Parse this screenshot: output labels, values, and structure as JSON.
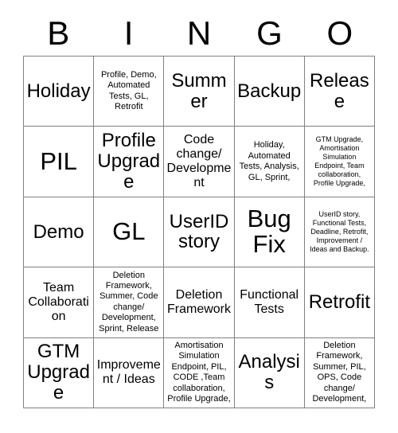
{
  "header": {
    "letters": [
      "B",
      "I",
      "N",
      "G",
      "O"
    ]
  },
  "grid": {
    "columns": 5,
    "rows": 5,
    "border_color": "#808080",
    "background_color": "#ffffff",
    "text_color": "#000000",
    "cells": [
      {
        "text": "Holiday",
        "size": "xl"
      },
      {
        "text": "Profile, Demo, Automated Tests, GL, Retrofit",
        "size": "sm"
      },
      {
        "text": "Summer",
        "size": "xl"
      },
      {
        "text": "Backup",
        "size": "xl"
      },
      {
        "text": "Release",
        "size": "xl"
      },
      {
        "text": "PIL",
        "size": "xxl"
      },
      {
        "text": "Profile Upgrade",
        "size": "xl"
      },
      {
        "text": "Code change/ Development",
        "size": "md"
      },
      {
        "text": "Holiday, Automated Tests, Analysis, GL, Sprint,",
        "size": "sm"
      },
      {
        "text": "GTM Upgrade, Amortisation Simulation Endpoint, Team collaboration, Profile Upgrade,",
        "size": "xs"
      },
      {
        "text": "Demo",
        "size": "xl"
      },
      {
        "text": "GL",
        "size": "xxl"
      },
      {
        "text": "UserID story",
        "size": "xl"
      },
      {
        "text": "Bug Fix",
        "size": "xxl"
      },
      {
        "text": "UserID story, Functional Tests, Deadline, Retrofit, Improvement / Ideas and Backup.",
        "size": "xs"
      },
      {
        "text": "Team Collaboration",
        "size": "md"
      },
      {
        "text": "Deletion Framework, Summer, Code change/ Development, Sprint, Release",
        "size": "sm"
      },
      {
        "text": "Deletion Framework",
        "size": "md"
      },
      {
        "text": "Functional Tests",
        "size": "md"
      },
      {
        "text": "Retrofit",
        "size": "xl"
      },
      {
        "text": "GTM Upgrade",
        "size": "xl"
      },
      {
        "text": "Improvement / Ideas",
        "size": "md"
      },
      {
        "text": "Amortisation Simulation Endpoint, PIL, CODE ,Team collaboration, Profile Upgrade,",
        "size": "sm"
      },
      {
        "text": "Analysis",
        "size": "xl"
      },
      {
        "text": "Deletion Framework, Summer, PIL, OPS, Code change/ Development,",
        "size": "sm"
      }
    ]
  }
}
